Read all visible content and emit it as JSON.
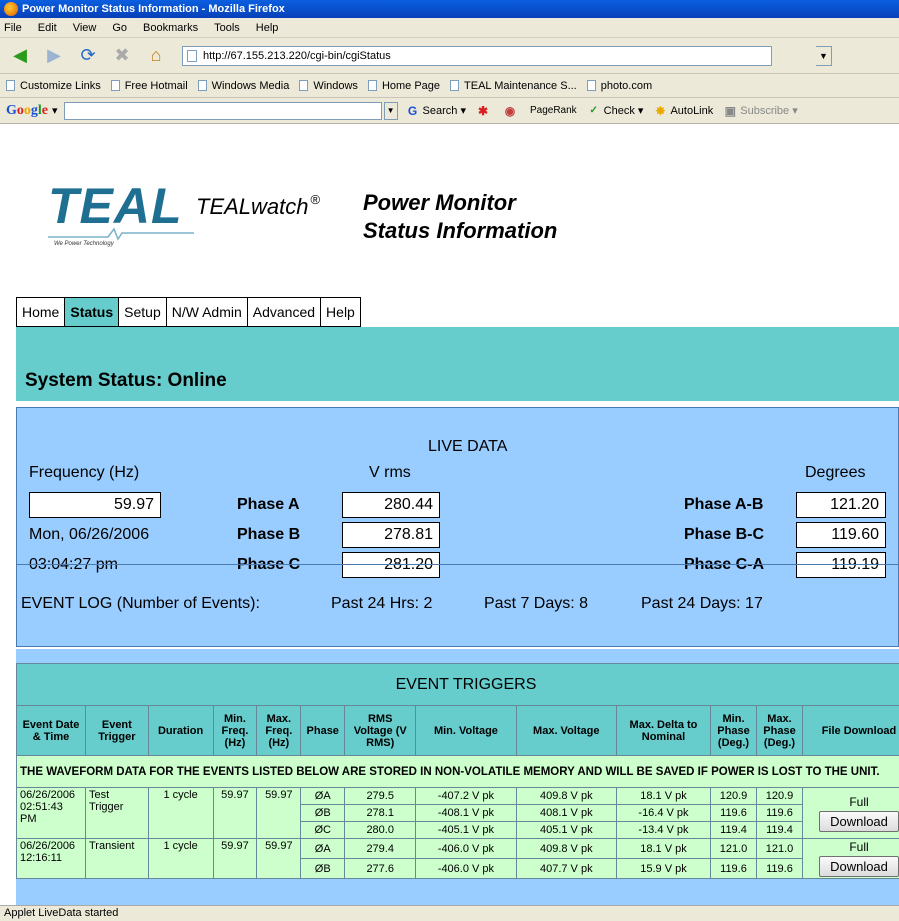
{
  "window": {
    "title": "Power Monitor Status Information - Mozilla Firefox"
  },
  "menu": [
    "File",
    "Edit",
    "View",
    "Go",
    "Bookmarks",
    "Tools",
    "Help"
  ],
  "address": {
    "url": "http://67.155.213.220/cgi-bin/cgiStatus"
  },
  "bookmarks": [
    "Customize Links",
    "Free Hotmail",
    "Windows Media",
    "Windows",
    "Home Page",
    "TEAL Maintenance S...",
    "photo.com"
  ],
  "google_toolbar": {
    "logo": [
      "G",
      "o",
      "o",
      "g",
      "l",
      "e"
    ],
    "dropdown": "▾",
    "search": "Search",
    "pagerank": "PageRank",
    "check": "Check",
    "autolink": "AutoLink",
    "subscribe": "Subscribe"
  },
  "page": {
    "logo_text": "TEAL",
    "logo_tagline": "We Power Technology",
    "product": "TEALwatch",
    "registered": "®",
    "title_line1": "Power Monitor",
    "title_line2": "Status Information",
    "tabs": [
      "Home",
      "Status",
      "Setup",
      "N/W Admin",
      "Advanced",
      "Help"
    ],
    "active_tab": "Status",
    "system_status": "System Status: Online"
  },
  "live": {
    "heading": "LIVE DATA",
    "freq_label": "Frequency (Hz)",
    "vrms_label": "V rms",
    "deg_label": "Degrees",
    "frequency": "59.97",
    "date": "Mon, 06/26/2006",
    "time": "03:04:27 pm",
    "phases": [
      {
        "label": "Phase A",
        "value": "280.44"
      },
      {
        "label": "Phase B",
        "value": "278.81"
      },
      {
        "label": "Phase C",
        "value": "281.20"
      }
    ],
    "angles": [
      {
        "label": "Phase A-B",
        "value": "121.20"
      },
      {
        "label": "Phase B-C",
        "value": "119.60"
      },
      {
        "label": "Phase C-A",
        "value": "119.19"
      }
    ],
    "event_log_label": "EVENT LOG (Number of Events):",
    "past24hrs": "Past 24 Hrs: 2",
    "past7days": "Past 7 Days: 8",
    "past24days": "Past 24 Days: 17"
  },
  "triggers": {
    "title": "EVENT TRIGGERS",
    "headers": [
      "Event Date & Time",
      "Event Trigger",
      "Duration",
      "Min. Freq. (Hz)",
      "Max. Freq. (Hz)",
      "Phase",
      "RMS Voltage (V RMS)",
      "Min. Voltage",
      "Max. Voltage",
      "Max. Delta to Nominal",
      "Min. Phase (Deg.)",
      "Max. Phase (Deg.)",
      "File Download"
    ],
    "note": "THE WAVEFORM DATA FOR THE EVENTS LISTED BELOW ARE STORED IN NON-VOLATILE MEMORY AND WILL BE SAVED IF POWER IS LOST TO THE UNIT.",
    "events": [
      {
        "datetime": "06/26/2006 02:51:43 PM",
        "trigger": "Test Trigger",
        "duration": "1 cycle",
        "min_freq": "59.97",
        "max_freq": "59.97",
        "download_label": "Full",
        "download_button": "Download",
        "phases": [
          {
            "phase": "ØA",
            "rms": "279.5",
            "min_v": "-407.2 V pk",
            "max_v": "409.8 V pk",
            "delta": "18.1 V pk",
            "min_ph": "120.9",
            "max_ph": "120.9"
          },
          {
            "phase": "ØB",
            "rms": "278.1",
            "min_v": "-408.1 V pk",
            "max_v": "408.1 V pk",
            "delta": "-16.4 V pk",
            "min_ph": "119.6",
            "max_ph": "119.6"
          },
          {
            "phase": "ØC",
            "rms": "280.0",
            "min_v": "-405.1 V pk",
            "max_v": "405.1 V pk",
            "delta": "-13.4 V pk",
            "min_ph": "119.4",
            "max_ph": "119.4"
          }
        ]
      },
      {
        "datetime": "06/26/2006 12:16:11",
        "trigger": "Transient",
        "duration": "1 cycle",
        "min_freq": "59.97",
        "max_freq": "59.97",
        "download_label": "Full",
        "download_button": "Download",
        "phases": [
          {
            "phase": "ØA",
            "rms": "279.4",
            "min_v": "-406.0 V pk",
            "max_v": "409.8 V pk",
            "delta": "18.1 V pk",
            "min_ph": "121.0",
            "max_ph": "121.0"
          },
          {
            "phase": "ØB",
            "rms": "277.6",
            "min_v": "-406.0 V pk",
            "max_v": "407.7 V pk",
            "delta": "15.9 V pk",
            "min_ph": "119.6",
            "max_ph": "119.6"
          }
        ]
      }
    ]
  },
  "statusbar": "Applet LiveData started"
}
